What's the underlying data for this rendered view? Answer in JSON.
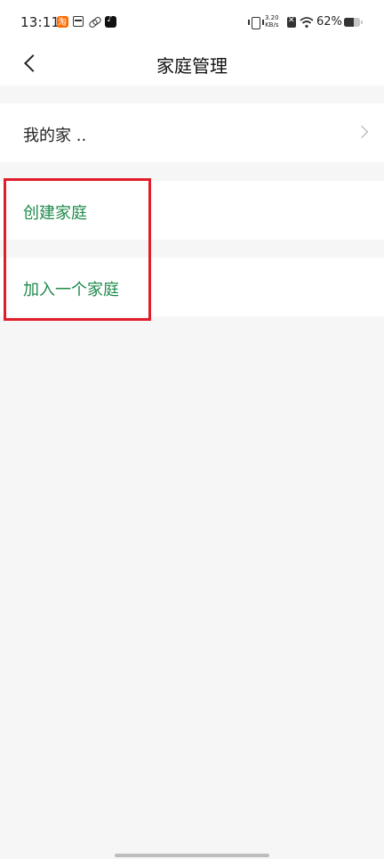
{
  "status_bar": {
    "time": "13:11",
    "net_speed_value": "3.20",
    "net_speed_unit": "KB/s",
    "battery_percent": "62%",
    "battery_level": 0.62,
    "icons": [
      "taobao-icon",
      "box-icon",
      "link-icon",
      "tiktok-icon",
      "vibrate-icon",
      "no-sim-icon",
      "wifi-icon",
      "battery-icon"
    ]
  },
  "header": {
    "title": "家庭管理",
    "back_icon": "chevron-left-icon"
  },
  "list": {
    "my_home_label": "我的家 ..",
    "create_family_label": "创建家庭",
    "join_family_label": "加入一个家庭"
  },
  "colors": {
    "accent_green": "#1f8a4c",
    "highlight_red": "#e01e2a",
    "background": "#f6f6f6"
  }
}
